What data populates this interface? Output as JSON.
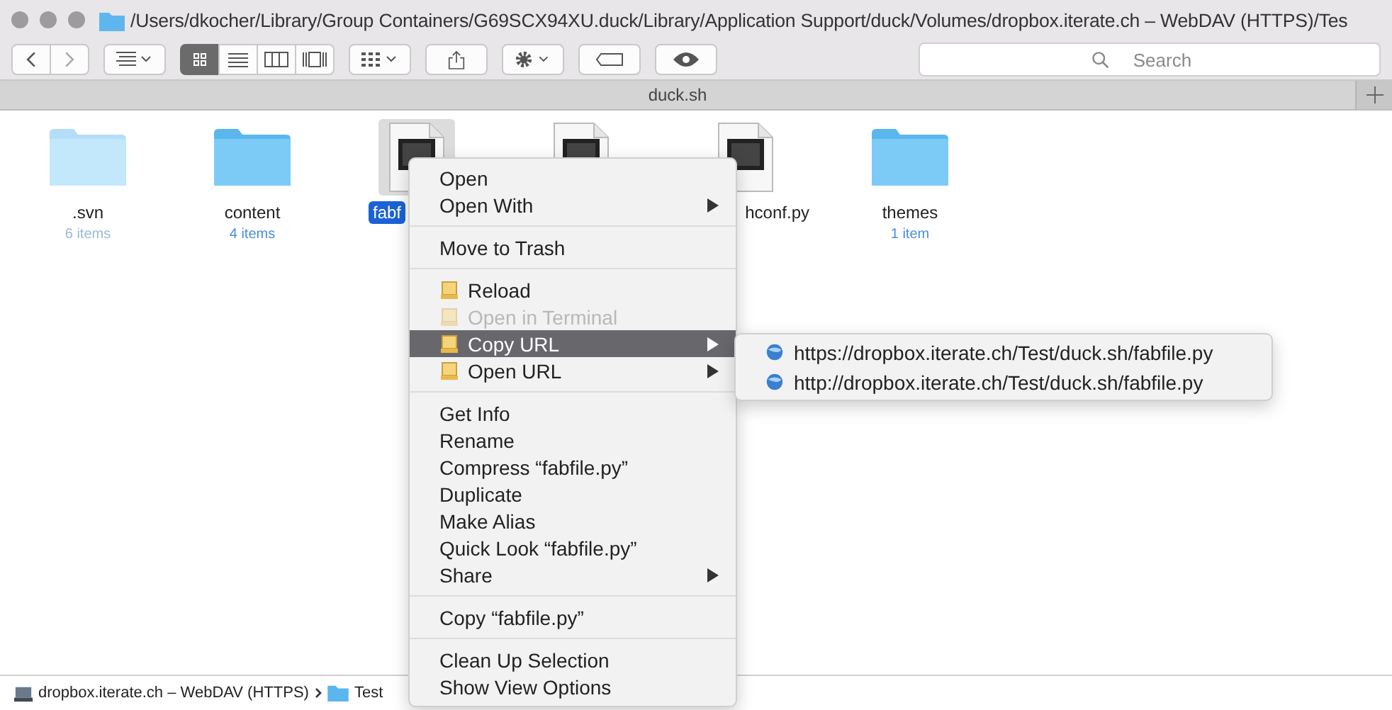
{
  "window": {
    "title": "/Users/dkocher/Library/Group Containers/G69SCX94XU.duck/Library/Application Support/duck/Volumes/dropbox.iterate.ch – WebDAV (HTTPS)/Tes"
  },
  "toolbar": {
    "view_modes": [
      {
        "kind": "icons",
        "selected": true
      },
      {
        "kind": "list",
        "selected": false
      },
      {
        "kind": "columns",
        "selected": false
      },
      {
        "kind": "gallery",
        "selected": false
      }
    ],
    "search": {
      "placeholder": "Search"
    }
  },
  "tabs": [
    {
      "label": "duck.sh"
    }
  ],
  "files": [
    {
      "kind": "folder",
      "name": ".svn",
      "detail": "6 items",
      "selected": false,
      "faded": true
    },
    {
      "kind": "folder",
      "name": "content",
      "detail": "4 items",
      "selected": false,
      "faded": false
    },
    {
      "kind": "python",
      "name": "fabf",
      "selected": true
    },
    {
      "kind": "python",
      "selected": false
    },
    {
      "kind": "python",
      "name": "hconf.py",
      "selected": false
    },
    {
      "kind": "folder",
      "name": "themes",
      "detail": "1 item",
      "selected": false,
      "faded": false
    }
  ],
  "context_menu": {
    "items": [
      {
        "kind": "item",
        "label": "Open",
        "icon": false,
        "disabled": false,
        "selected": false,
        "submenu": false
      },
      {
        "kind": "item",
        "label": "Open With",
        "icon": false,
        "disabled": false,
        "selected": false,
        "submenu": true
      },
      {
        "kind": "separator"
      },
      {
        "kind": "item",
        "label": "Move to Trash",
        "icon": false,
        "disabled": false,
        "selected": false,
        "submenu": false
      },
      {
        "kind": "separator"
      },
      {
        "kind": "item",
        "label": "Reload",
        "icon": true,
        "disabled": false,
        "selected": false,
        "submenu": false
      },
      {
        "kind": "item",
        "label": "Open in Terminal",
        "icon": true,
        "disabled": true,
        "selected": false,
        "submenu": false
      },
      {
        "kind": "item",
        "label": "Copy URL",
        "icon": true,
        "disabled": false,
        "selected": true,
        "submenu": true
      },
      {
        "kind": "item",
        "label": "Open URL",
        "icon": true,
        "disabled": false,
        "selected": false,
        "submenu": true
      },
      {
        "kind": "separator"
      },
      {
        "kind": "item",
        "label": "Get Info",
        "icon": false,
        "disabled": false,
        "selected": false,
        "submenu": false
      },
      {
        "kind": "item",
        "label": "Rename",
        "icon": false,
        "disabled": false,
        "selected": false,
        "submenu": false
      },
      {
        "kind": "item",
        "label": "Compress “fabfile.py”",
        "icon": false,
        "disabled": false,
        "selected": false,
        "submenu": false
      },
      {
        "kind": "item",
        "label": "Duplicate",
        "icon": false,
        "disabled": false,
        "selected": false,
        "submenu": false
      },
      {
        "kind": "item",
        "label": "Make Alias",
        "icon": false,
        "disabled": false,
        "selected": false,
        "submenu": false
      },
      {
        "kind": "item",
        "label": "Quick Look “fabfile.py”",
        "icon": false,
        "disabled": false,
        "selected": false,
        "submenu": false
      },
      {
        "kind": "item",
        "label": "Share",
        "icon": false,
        "disabled": false,
        "selected": false,
        "submenu": true
      },
      {
        "kind": "separator"
      },
      {
        "kind": "item",
        "label": "Copy “fabfile.py”",
        "icon": false,
        "disabled": false,
        "selected": false,
        "submenu": false
      },
      {
        "kind": "separator"
      },
      {
        "kind": "item",
        "label": "Clean Up Selection",
        "icon": false,
        "disabled": false,
        "selected": false,
        "submenu": false
      },
      {
        "kind": "item",
        "label": "Show View Options",
        "icon": false,
        "disabled": false,
        "selected": false,
        "submenu": false
      }
    ]
  },
  "submenu": {
    "items": [
      {
        "label": "https://dropbox.iterate.ch/Test/duck.sh/fabfile.py"
      },
      {
        "label": "http://dropbox.iterate.ch/Test/duck.sh/fabfile.py"
      }
    ]
  },
  "path_bar": {
    "items": [
      {
        "kind": "drive",
        "label": "dropbox.iterate.ch – WebDAV (HTTPS)"
      },
      {
        "kind": "folder",
        "label": "Test"
      }
    ]
  }
}
